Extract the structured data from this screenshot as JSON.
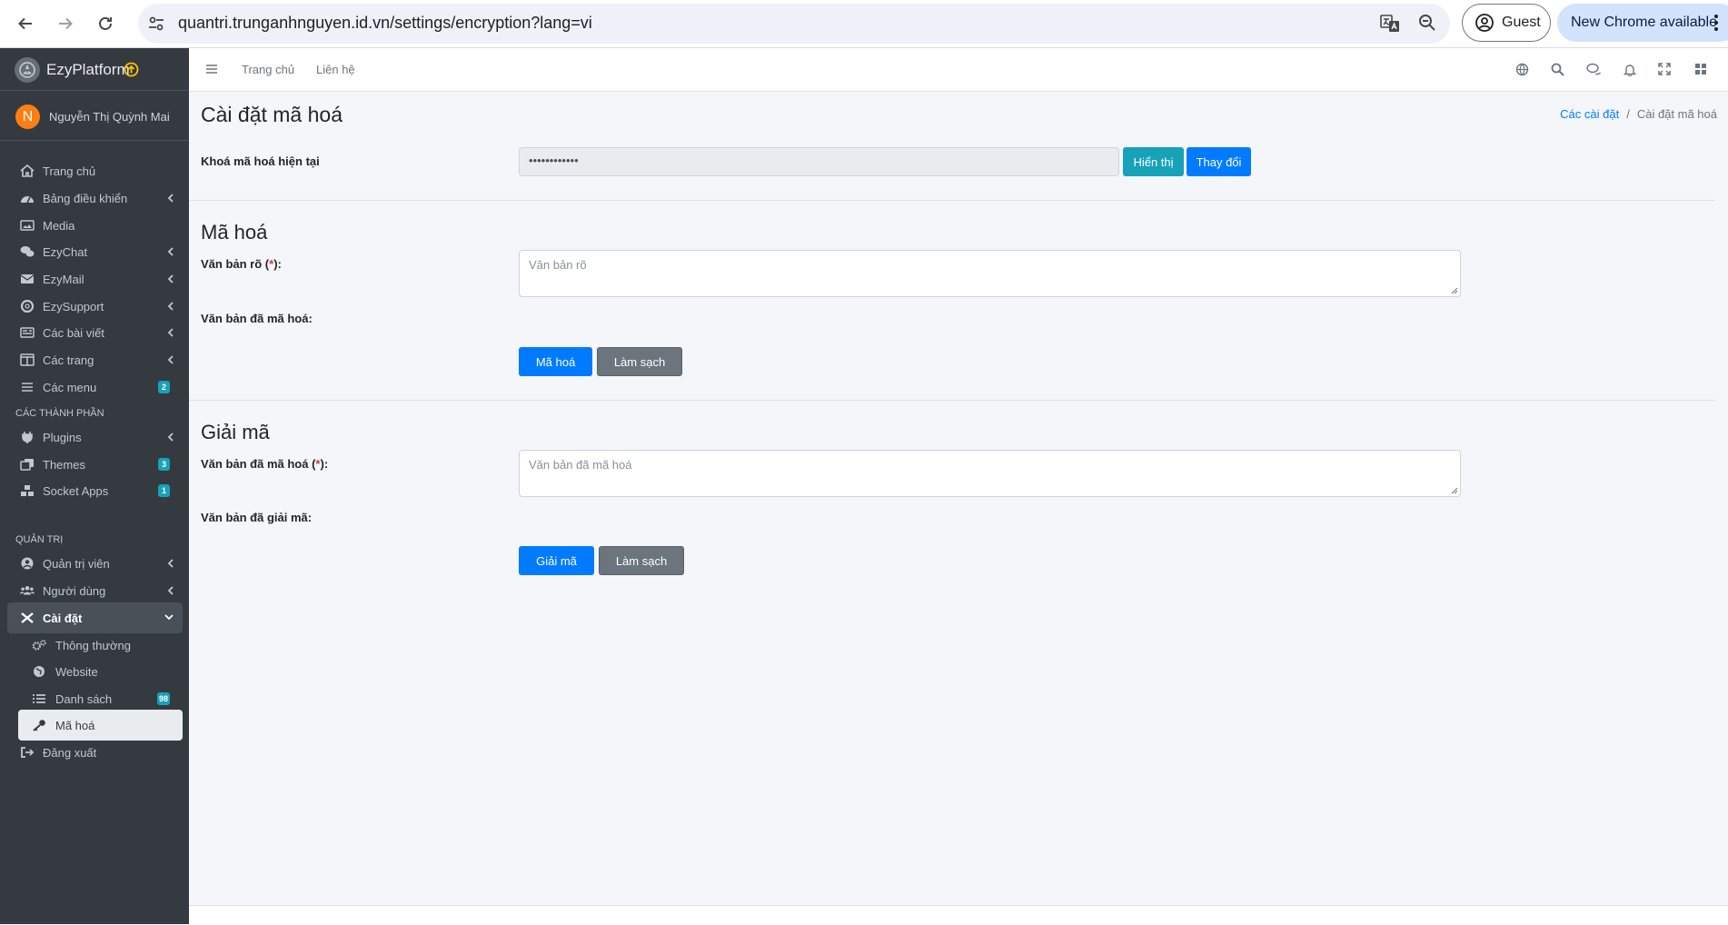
{
  "browser": {
    "url": "quantri.trunganhnguyen.id.vn/settings/encryption?lang=vi",
    "profile_label": "Guest",
    "update_label": "New Chrome available"
  },
  "sidebar": {
    "brand": "EzyPlatform",
    "user_initial": "N",
    "user_name": "Nguyễn Thị Quỳnh Mai",
    "items": [
      {
        "label": "Trang chủ",
        "icon": "home-icon"
      },
      {
        "label": "Bảng điều khiển",
        "icon": "dashboard-icon"
      },
      {
        "label": "Media",
        "icon": "image-icon"
      },
      {
        "label": "EzyChat",
        "icon": "chat-icon"
      },
      {
        "label": "EzyMail",
        "icon": "mail-icon"
      },
      {
        "label": "EzySupport",
        "icon": "lifebuoy-icon"
      },
      {
        "label": "Các bài viết",
        "icon": "newspaper-icon"
      },
      {
        "label": "Các trang",
        "icon": "columns-icon"
      },
      {
        "label": "Các menu",
        "icon": "bars-icon",
        "badge": "2"
      }
    ],
    "header_components": "CÁC THÀNH PHẦN",
    "component_items": [
      {
        "label": "Plugins",
        "icon": "plug-icon"
      },
      {
        "label": "Themes",
        "icon": "clone-icon",
        "badge": "3"
      },
      {
        "label": "Socket Apps",
        "icon": "cubes-icon",
        "badge": "1"
      }
    ],
    "header_admin": "QUẢN TRỊ",
    "admin_items": [
      {
        "label": "Quản trị viên",
        "icon": "user-circle-icon"
      },
      {
        "label": "Người dùng",
        "icon": "users-icon"
      },
      {
        "label": "Cài đặt",
        "icon": "tools-icon"
      }
    ],
    "settings_sub": [
      {
        "label": "Thông thường",
        "icon": "cogs-icon"
      },
      {
        "label": "Website",
        "icon": "globe-icon"
      },
      {
        "label": "Danh sách",
        "icon": "list-icon",
        "badge": "98"
      },
      {
        "label": "Mã hoá",
        "icon": "key-icon"
      }
    ],
    "logout": "Đăng xuất"
  },
  "topnav": {
    "home_link": "Trang chủ",
    "contact_link": "Liên hệ"
  },
  "page": {
    "title": "Cài đặt mã hoá",
    "breadcrumb_parent": "Các cài đặt",
    "breadcrumb_separator": "/",
    "breadcrumb_current": "Cài đặt mã hoá",
    "current_key_label": "Khoá mã hoá hiện tại",
    "current_key_value": "••••••••••••",
    "show_button": "Hiển thị",
    "change_button": "Thay đổi",
    "encrypt_title": "Mã hoá",
    "plain_label_prefix": "Văn bản rõ (",
    "required_mark": "*",
    "label_suffix": "):",
    "plain_placeholder": "Văn bản rõ",
    "encrypted_result_label": "Văn bản đã mã hoá:",
    "encrypt_button": "Mã hoá",
    "clear_button": "Làm sạch",
    "decrypt_title": "Giải mã",
    "cipher_label_prefix": "Văn bản đã mã hoá (",
    "cipher_placeholder": "Văn bản đã mã hoá",
    "decrypted_result_label": "Văn bản đã giải mã:",
    "decrypt_button": "Giải mã"
  }
}
